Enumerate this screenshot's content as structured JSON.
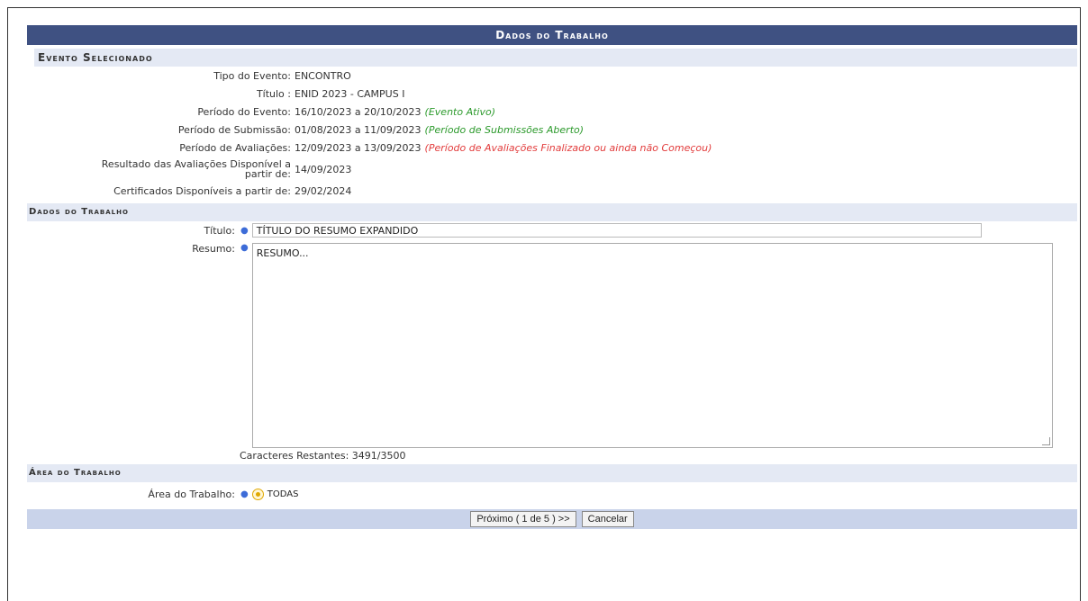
{
  "header": {
    "title": "Dados do Trabalho"
  },
  "evento": {
    "section_title": "Evento Selecionado",
    "rows": [
      {
        "label": "Tipo do Evento:",
        "value": "ENCONTRO"
      },
      {
        "label": "Título :",
        "value": "ENID 2023 - CAMPUS I"
      },
      {
        "label": "Período do Evento:",
        "value": "16/10/2023 a 20/10/2023",
        "status": "(Evento Ativo)"
      },
      {
        "label": "Período de Submissão:",
        "value": "01/08/2023 a 11/09/2023",
        "status": "(Período de Submissões Aberto)"
      },
      {
        "label": "Período de Avaliações:",
        "value": "12/09/2023 a 13/09/2023",
        "status": "(Período de Avaliações Finalizado ou ainda não Começou)"
      },
      {
        "label_line1": "Resultado das Avaliações Disponível a",
        "label_line2": "partir de:",
        "value": "14/09/2023"
      },
      {
        "label": "Certificados Disponíveis a partir de:",
        "value": "29/02/2024"
      }
    ]
  },
  "trabalho": {
    "section_title": "Dados do Trabalho",
    "titulo_label": "Título:",
    "titulo_value": "TÍTULO DO RESUMO EXPANDIDO",
    "resumo_label": "Resumo:",
    "resumo_value": "RESUMO...",
    "chars_remaining": "Caracteres Restantes: 3491/3500"
  },
  "area": {
    "section_title": "Área do Trabalho",
    "label": "Área do Trabalho:",
    "option": "TODAS"
  },
  "footer": {
    "next_label": "Próximo ( 1 de 5 ) >>",
    "cancel_label": "Cancelar"
  },
  "colors": {
    "header": "#3f5182",
    "active_status": "#2c9a2c",
    "closed_status": "#e23c3c",
    "required": "#3d6cd8"
  }
}
